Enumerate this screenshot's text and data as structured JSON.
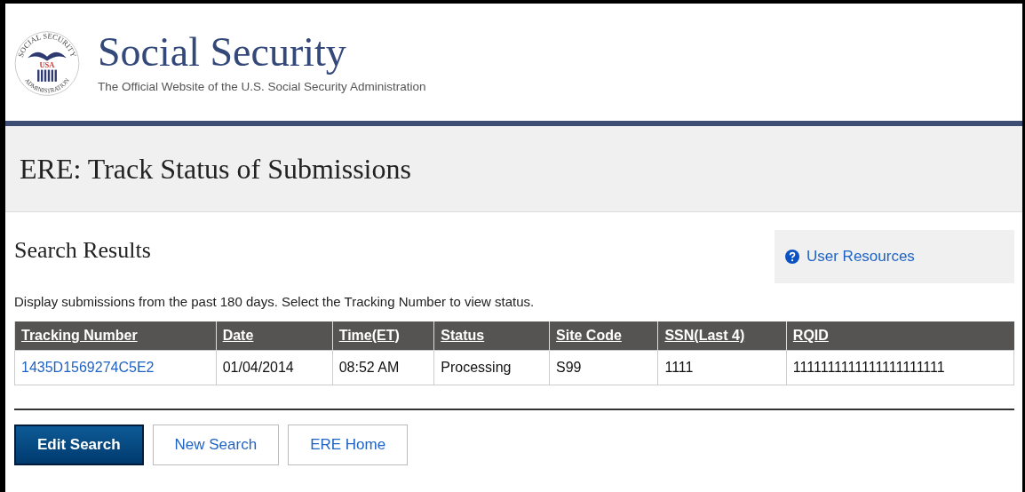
{
  "header": {
    "seal": {
      "top_text": "SOCIAL SECURITY",
      "center_text": "USA",
      "bottom_text": "ADMINISTRATION"
    },
    "title": "Social Security",
    "tagline": "The Official Website of the U.S. Social Security Administration"
  },
  "page_title": "ERE: Track Status of Submissions",
  "section_title": "Search Results",
  "user_resources": {
    "label": "User Resources"
  },
  "instructions": "Display submissions from the past 180 days. Select the Tracking Number to view status.",
  "table": {
    "columns": [
      "Tracking Number",
      "Date",
      "Time(ET)",
      "Status",
      "Site Code",
      "SSN(Last 4)",
      "RQID"
    ],
    "rows": [
      [
        "1435D1569274C5E2",
        "01/04/2014",
        "08:52 AM",
        "Processing",
        "S99",
        "1111",
        "1111111111111111111111"
      ]
    ]
  },
  "buttons": [
    {
      "label": "Edit Search",
      "kind": "primary"
    },
    {
      "label": "New Search",
      "kind": "secondary"
    },
    {
      "label": "ERE Home",
      "kind": "secondary"
    }
  ]
}
